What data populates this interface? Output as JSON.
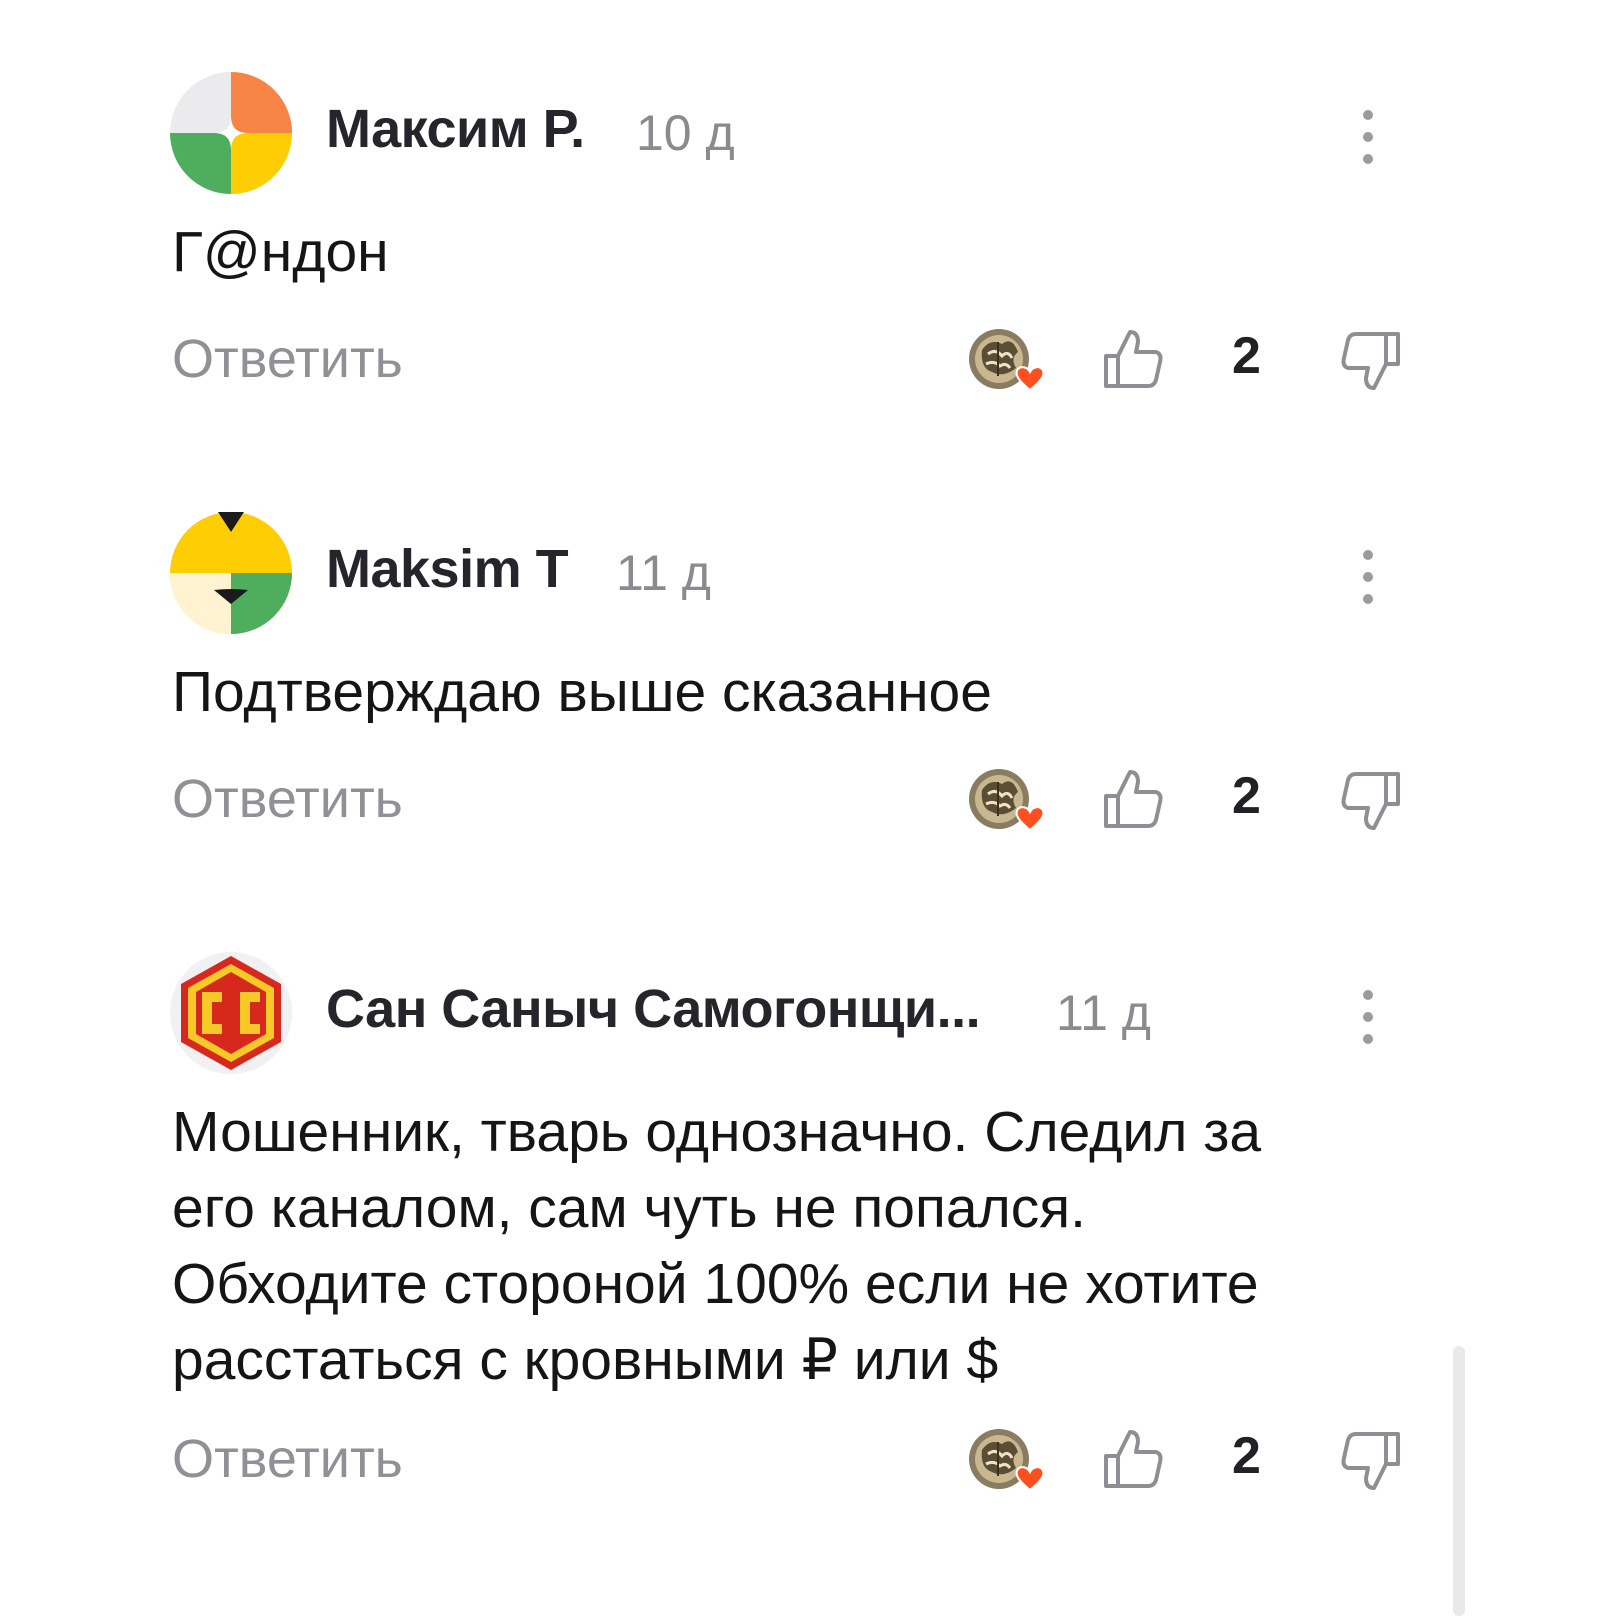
{
  "comments": [
    {
      "author": "Максим Р.",
      "time": "10 д",
      "text_lines": [
        "Г@ндон"
      ],
      "reply_label": "Ответить",
      "likes": "2",
      "avatar_icon": "quadrant-avatar-orange-yellow-green"
    },
    {
      "author": "Maksim T",
      "time": "11 д",
      "text_lines": [
        "Подтверждаю выше сказанное"
      ],
      "reply_label": "Ответить",
      "likes": "2",
      "avatar_icon": "quadrant-avatar-yellow-green"
    },
    {
      "author": "Сан Саныч Самогонщи...",
      "time": "11 д",
      "text_lines": [
        "Мошенник, тварь однозначно. Следил за",
        "его каналом, сам чуть не попался.",
        "Обходите стороной 100% если не хотите",
        "расстаться с кровными ₽ или $"
      ],
      "reply_label": "Ответить",
      "likes": "2",
      "avatar_icon": "cc-hexagon-logo"
    }
  ],
  "colors": {
    "author": "#25252b",
    "time": "#8a8a90",
    "reply": "#909096",
    "heart": "#ff4f1f",
    "avatar_orange": "#f68445",
    "avatar_yellow": "#ffcd03",
    "avatar_green": "#4fae5e"
  }
}
